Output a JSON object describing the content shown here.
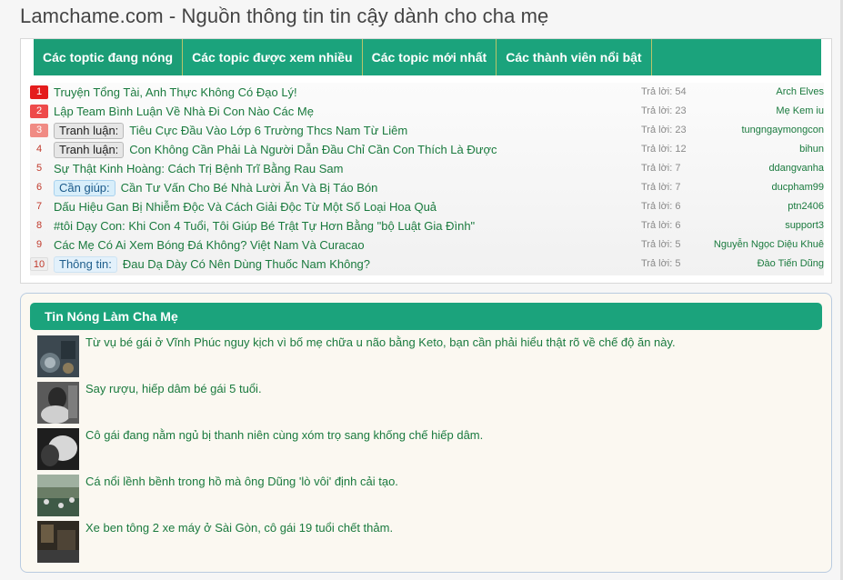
{
  "site": {
    "title": "Lamchame.com - Nguồn thông tin tin cậy dành cho cha mẹ"
  },
  "tabs": [
    {
      "label": "Các toptic đang nóng"
    },
    {
      "label": "Các topic được xem nhiều"
    },
    {
      "label": "Các topic mới nhất"
    },
    {
      "label": "Các thành viên nổi bật"
    }
  ],
  "topics": [
    {
      "rank": "1",
      "prefix": "",
      "title": "Truyện Tổng Tài, Anh Thực Không Có Đạo Lý!",
      "replies": "Trả lời: 54",
      "author": "Arch Elves"
    },
    {
      "rank": "2",
      "prefix": "",
      "title": "Lập Team Bình Luận Về Nhà Đi Con Nào Các Mẹ",
      "replies": "Trả lời: 23",
      "author": "Mẹ Kem iu"
    },
    {
      "rank": "3",
      "prefix": "Tranh luận:",
      "title": "Tiêu Cực Đầu Vào Lớp 6 Trường Thcs Nam Từ Liêm",
      "replies": "Trả lời: 23",
      "author": "tungngaymongcon"
    },
    {
      "rank": "4",
      "prefix": "Tranh luận:",
      "title": "Con Không Cần Phải Là Người Dẫn Đầu Chỉ Cần Con Thích Là Được",
      "replies": "Trả lời: 12",
      "author": "bihun"
    },
    {
      "rank": "5",
      "prefix": "",
      "title": "Sự Thật Kinh Hoàng: Cách Trị Bệnh Trĩ Bằng Rau Sam",
      "replies": "Trả lời: 7",
      "author": "ddangvanha"
    },
    {
      "rank": "6",
      "prefix": "Cần giúp:",
      "title": "Cần Tư Vấn Cho Bé Nhà Lười Ăn Và Bị Táo Bón",
      "replies": "Trả lời: 7",
      "author": "ducpham99"
    },
    {
      "rank": "7",
      "prefix": "",
      "title": "Dấu Hiệu Gan Bị Nhiễm Độc Và Cách Giải Độc Từ Một Số Loại Hoa Quả",
      "replies": "Trả lời: 6",
      "author": "ptn2406"
    },
    {
      "rank": "8",
      "prefix": "",
      "title": "#tôi Dạy Con: Khi Con 4 Tuổi, Tôi Giúp Bé Trật Tự Hơn Bằng \"bộ Luật Gia Đình\"",
      "replies": "Trả lời: 6",
      "author": "support3"
    },
    {
      "rank": "9",
      "prefix": "",
      "title": "Các Mẹ Có Ai Xem Bóng Đá Không? Việt Nam Và Curacao",
      "replies": "Trả lời: 5",
      "author": "Nguyễn Ngọc Diệu Khuê"
    },
    {
      "rank": "10",
      "prefix": "Thông tin:",
      "title": "Đau Dạ Dày Có Nên Dùng Thuốc Nam Không?",
      "replies": "Trả lời: 5",
      "author": "Đào Tiến Dũng"
    }
  ],
  "news": {
    "header": "Tin Nóng Làm Cha Mẹ",
    "items": [
      {
        "text": "Từ vụ bé gái ở Vĩnh Phúc nguy kịch vì bố mẹ chữa u não bằng Keto, bạn cần phải hiểu thật rõ về chế độ ăn này."
      },
      {
        "text": "Say rượu, hiếp dâm bé gái 5 tuổi."
      },
      {
        "text": "Cô gái đang nằm ngủ bị thanh niên cùng xóm trọ sang khống chế hiếp dâm."
      },
      {
        "text": "Cá nổi lềnh bềnh trong hồ mà ông Dũng 'lò vôi' định cải tạo."
      },
      {
        "text": "Xe ben tông 2 xe máy ở Sài Gòn, cô gái 19 tuổi chết thảm."
      }
    ]
  },
  "colors": {
    "accent": "#1ba37c",
    "link": "#1a7a3e",
    "rank_top": "#e41c1c"
  }
}
